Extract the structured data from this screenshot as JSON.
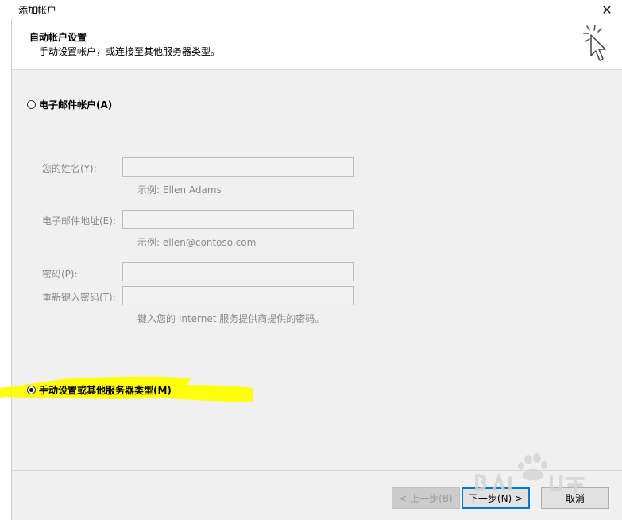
{
  "window": {
    "title": "添加帐户",
    "close_glyph": "✕"
  },
  "header": {
    "title": "自动帐户设置",
    "subtitle": "手动设置帐户，或连接至其他服务器类型。"
  },
  "options": {
    "email_account": {
      "label": "电子邮件帐户(A)",
      "selected": false
    },
    "manual_setup": {
      "label": "手动设置或其他服务器类型(M)",
      "selected": true
    }
  },
  "form": {
    "name_label": "您的姓名(Y):",
    "name_value": "",
    "name_hint": "示例: Ellen Adams",
    "email_label": "电子邮件地址(E):",
    "email_value": "",
    "email_hint": "示例: ellen@contoso.com",
    "password_label": "密码(P):",
    "password_value": "",
    "retype_label": "重新键入密码(T):",
    "retype_value": "",
    "password_hint": "键入您的 Internet 服务提供商提供的密码。"
  },
  "buttons": {
    "back": "< 上一步(B)",
    "next": "下一步(N) >",
    "cancel": "取消"
  },
  "icons": {
    "close": "close-icon",
    "wizard_cursor": "click-cursor-icon"
  },
  "colors": {
    "highlight": "#ffff00",
    "default_button_border": "#0078d7"
  }
}
